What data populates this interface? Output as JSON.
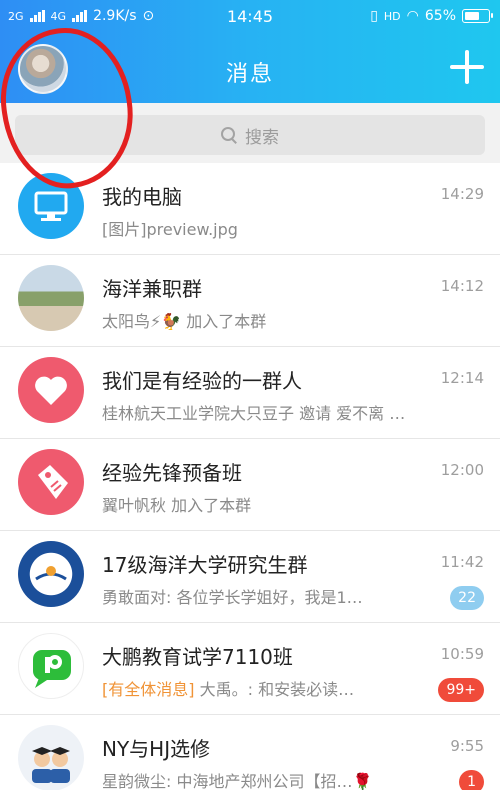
{
  "status_bar": {
    "net1": "2G",
    "net2": "4G",
    "speed": "2.9K/s",
    "time": "14:45",
    "hd": "HD",
    "battery": "65%",
    "battery_level": 0.65
  },
  "header": {
    "title": "消息"
  },
  "search": {
    "placeholder": "搜索"
  },
  "conversations": [
    {
      "name": "我的电脑",
      "preview_prefix": "",
      "preview": "[图片]preview.jpg",
      "time": "14:29",
      "badge": ""
    },
    {
      "name": "海洋兼职群",
      "preview_prefix": "",
      "preview": "太阳鸟⚡🐓 加入了本群",
      "time": "14:12",
      "badge": ""
    },
    {
      "name": "我们是有经验的一群人",
      "preview_prefix": "",
      "preview": "桂林航天工业学院大只豆子 邀请 爱不离 …",
      "time": "12:14",
      "badge": ""
    },
    {
      "name": "经验先锋预备班",
      "preview_prefix": "",
      "preview": "翼叶帆秋 加入了本群",
      "time": "12:00",
      "badge": ""
    },
    {
      "name": "17级海洋大学研究生群",
      "preview_prefix": "",
      "preview": "勇敢面对: 各位学长学姐好，我是1…",
      "time": "11:42",
      "badge": "22"
    },
    {
      "name": "大鹏教育试学7110班",
      "preview_prefix": "[有全体消息]",
      "preview": " 大禹。: 和安装必读…",
      "time": "10:59",
      "badge": "99+"
    },
    {
      "name": "NY与HJ选修",
      "preview_prefix": "",
      "preview": "星韵微尘: 中海地产郑州公司【招…🌹",
      "time": "9:55",
      "badge": "1"
    }
  ],
  "colors": {
    "header_start": "#2e8ef4",
    "header_end": "#1fc7ef",
    "badge_blue": "#8fcdf0",
    "badge_red": "#f04b3a",
    "annotation_red": "#e32020"
  }
}
